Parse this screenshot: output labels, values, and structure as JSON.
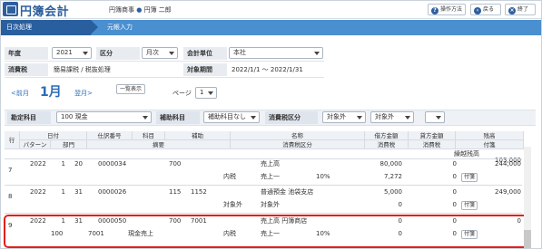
{
  "header": {
    "app_title": "円簿会計",
    "company_prefix": "円簿商事",
    "company_dot": "●",
    "company_user": "円簿 二郎",
    "help_label": "操作方法",
    "back_label": "戻る",
    "exit_label": "終了"
  },
  "nav": {
    "crumb_main": "日次処理",
    "crumb_sub": "元帳入力"
  },
  "form": {
    "year_label": "年度",
    "year_value": "2021",
    "kubun_label": "区分",
    "kubun_value": "月次",
    "unit_label": "会計単位",
    "unit_value": "本社",
    "tax_label": "消費税",
    "tax_value": "簡易課税 / 税抜処理",
    "period_label": "対象期間",
    "period_value": "2022/1/1 ～ 2022/1/31"
  },
  "month": {
    "prev": "<前月",
    "current": "1月",
    "next": "翌月>",
    "list_button": "一覧表示",
    "page_label": "ページ",
    "page_value": "1"
  },
  "filter": {
    "account_label": "勘定科目",
    "account_value": "100 現金",
    "sub_label": "補助科目",
    "sub_value": "補助科目なし",
    "taxclass_label": "消費税区分",
    "taxclass_value1": "対象外",
    "taxclass_value2": "対象外",
    "taxclass_value3": ""
  },
  "table": {
    "headers_top": [
      "行",
      "日付",
      "仕訳番号",
      "科目",
      "補助",
      "名称",
      "借方金額",
      "貸方金額",
      "残高"
    ],
    "headers_bottom": [
      "パターン",
      "部門",
      "摘要",
      "消費税区分",
      "消費税",
      "消費税",
      "付箋"
    ],
    "carry_label": "繰越残高",
    "carry_value": "103,000",
    "fusen_label": "付箋",
    "rows": [
      {
        "no": "7",
        "year": "2022",
        "month": "1",
        "day": "20",
        "slip": "0000034",
        "account": "700",
        "sub": "",
        "name": "売上高",
        "debit": "80,000",
        "credit": "0",
        "balance": "244,000",
        "pattern": "",
        "dept": "",
        "memo": "",
        "tax_in": "内税",
        "tax_class": "売上一",
        "rate": "10%",
        "tax_debit": "7,272",
        "tax_credit": "0"
      },
      {
        "no": "8",
        "year": "2022",
        "month": "1",
        "day": "31",
        "slip": "0000026",
        "account": "115",
        "sub": "1152",
        "name": "普通預金 池袋支店",
        "debit": "5,000",
        "credit": "0",
        "balance": "249,000",
        "pattern": "",
        "dept": "",
        "memo": "",
        "tax_in": "対象外",
        "tax_class": "対象外",
        "rate": "",
        "tax_debit": "0",
        "tax_credit": "0"
      },
      {
        "no": "9",
        "year": "2022",
        "month": "1",
        "day": "31",
        "slip": "0000050",
        "account": "700",
        "sub": "7001",
        "name": "売上高 円簿商店",
        "debit": "0",
        "credit": "0",
        "balance": "0",
        "pattern": "100",
        "dept": "7001",
        "memo": "現金売上",
        "tax_in": "内税",
        "tax_class": "売上一",
        "rate": "10%",
        "tax_debit": "0",
        "tax_credit": "0"
      }
    ]
  },
  "colors": {
    "brand": "#2e5f9e",
    "nav": "#4a8fd0",
    "highlight": "#e0201c"
  }
}
